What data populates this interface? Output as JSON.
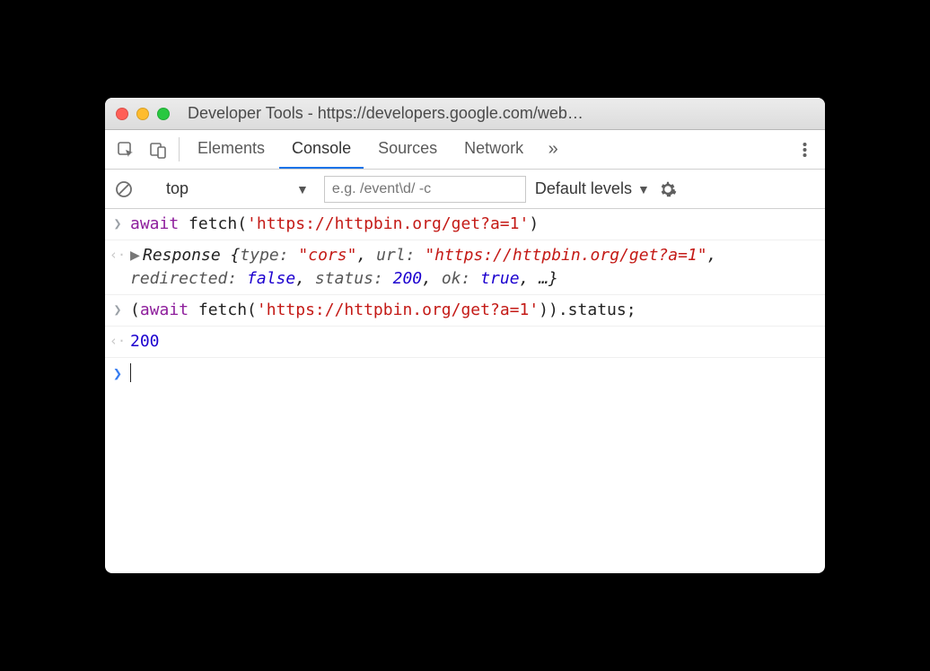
{
  "window": {
    "title": "Developer Tools - https://developers.google.com/web…"
  },
  "tabs": {
    "elements": "Elements",
    "console": "Console",
    "sources": "Sources",
    "network": "Network",
    "more": "»"
  },
  "filter": {
    "context": "top",
    "placeholder": "e.g. /event\\d/ -c",
    "levels": "Default levels"
  },
  "console": {
    "line1": {
      "await": "await",
      "fetch": " fetch(",
      "url": "'https://httpbin.org/get?a=1'",
      "close": ")"
    },
    "line2": {
      "response": "Response ",
      "type_k": "type: ",
      "type_v": "\"cors\"",
      "url_k": "url: ",
      "url_v": "\"https://httpbin.org/get?a=1\"",
      "redir_k": "redirected: ",
      "redir_v": "false",
      "status_k": "status: ",
      "status_v": "200",
      "ok_k": "ok: ",
      "ok_v": "true",
      "ellipsis": ", …}"
    },
    "line3": {
      "open": "(",
      "await": "await",
      "fetch": " fetch(",
      "url": "'https://httpbin.org/get?a=1'",
      "close": ")).status;"
    },
    "line4": {
      "value": "200"
    }
  }
}
